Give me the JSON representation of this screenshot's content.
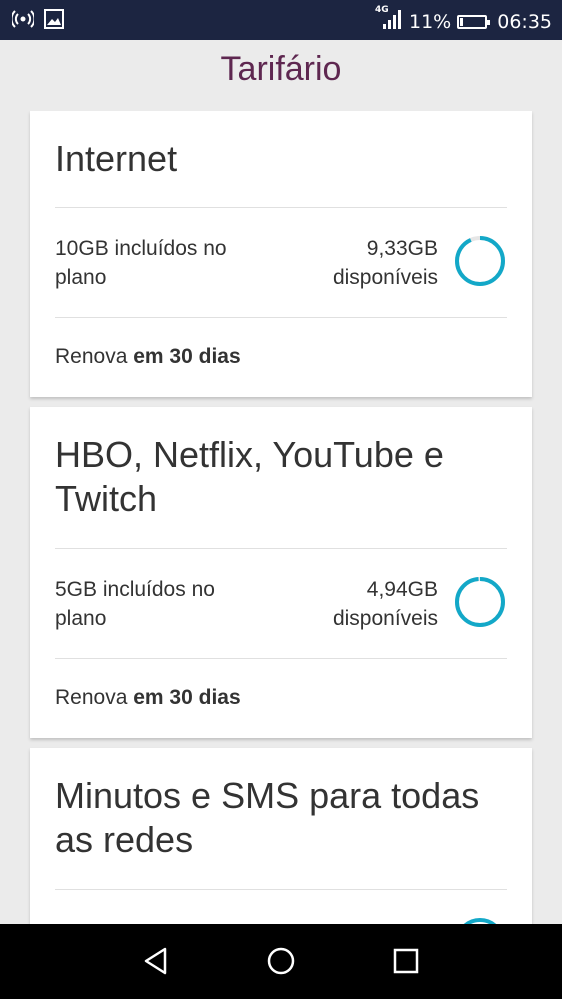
{
  "status_bar": {
    "left_icons": [
      "hotspot-icon",
      "image-icon"
    ],
    "network": "4G",
    "battery": "11%",
    "battery_level": 0.11,
    "time": "06:35"
  },
  "page": {
    "title": "Tarifário"
  },
  "cards": [
    {
      "title": "Internet",
      "included": "10GB incluídos no plano",
      "available_amount": "9,33GB",
      "available_label": "disponíveis",
      "usage_remaining_fraction": 0.933,
      "renew_prefix": "Renova",
      "renew_bold": "em 30 dias"
    },
    {
      "title": "HBO, Netflix, YouTube e Twitch",
      "included": "5GB incluídos no plano",
      "available_amount": "4,94GB",
      "available_label": "disponíveis",
      "usage_remaining_fraction": 0.988,
      "renew_prefix": "Renova",
      "renew_bold": "em 30 dias"
    },
    {
      "title": "Minutos e SMS para todas as redes"
    }
  ],
  "colors": {
    "accent": "#5e2750",
    "ring": "#13a8c8",
    "status_bar": "#1c2541"
  },
  "nav_bar": {
    "buttons": [
      "back-icon",
      "home-icon",
      "recents-icon"
    ]
  }
}
